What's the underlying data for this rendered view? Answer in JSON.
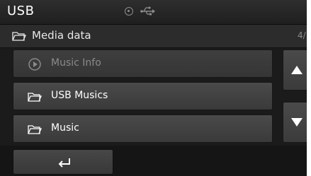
{
  "status_bar": {
    "title": "USB",
    "icons": [
      "disc-icon",
      "usb-icon"
    ]
  },
  "media_header": {
    "title": "Media data",
    "page_indicator": "4/",
    "icon": "folder-icon"
  },
  "list": [
    {
      "label": "Music Info",
      "icon": "play-circle-icon",
      "enabled": false
    },
    {
      "label": "USB Musics",
      "icon": "folder-icon",
      "enabled": true
    },
    {
      "label": "Music",
      "icon": "folder-icon",
      "enabled": true
    }
  ],
  "scroll": {
    "up_icon": "triangle-up-icon",
    "down_icon": "triangle-down-icon"
  },
  "bottom_bar": {
    "back_icon": "back-arrow-icon"
  },
  "colors": {
    "background": "#1b1b1b",
    "item": "#424242",
    "text": "#ffffff",
    "disabled_text": "#8a8a8a"
  }
}
